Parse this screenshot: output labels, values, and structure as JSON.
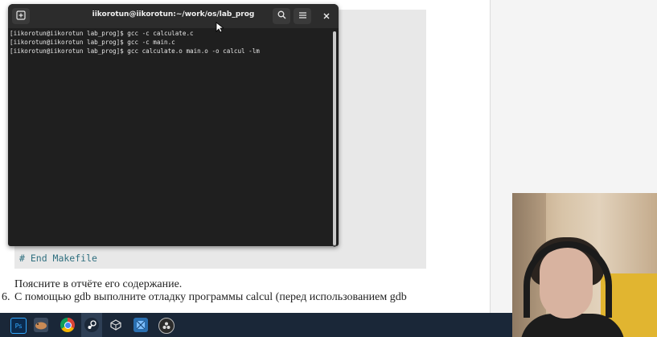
{
  "terminal": {
    "title": "iikorotun@iikorotun:~/work/os/lab_prog",
    "new_tab_icon": "new-tab-icon",
    "search_icon": "search-icon",
    "menu_icon": "hamburger-icon",
    "close_icon": "close-icon",
    "lines": [
      "[iikorotun@iikorotun lab_prog]$ gcc -c calculate.c",
      "[iikorotun@iikorotun lab_prog]$ gcc -c main.c",
      "[iikorotun@iikorotun lab_prog]$ gcc calculate.o main.o -o calcul -lm"
    ]
  },
  "document": {
    "code_comment": "# End Makefile",
    "paragraph": "Поясните в отчёте его содержание.",
    "list_number": "6.",
    "list_text": "С помощью gdb выполните отладку программы calcul (перед использованием gdb"
  },
  "taskbar": {
    "apps": [
      "photoshop-icon",
      "hamster-icon",
      "chrome-icon",
      "steam-icon",
      "unity-icon",
      "app-icon",
      "obs-icon"
    ]
  },
  "colors": {
    "terminal_bg": "#1f1f1f",
    "taskbar_bg": "#1a2738",
    "code_text": "#2f6f7f"
  }
}
